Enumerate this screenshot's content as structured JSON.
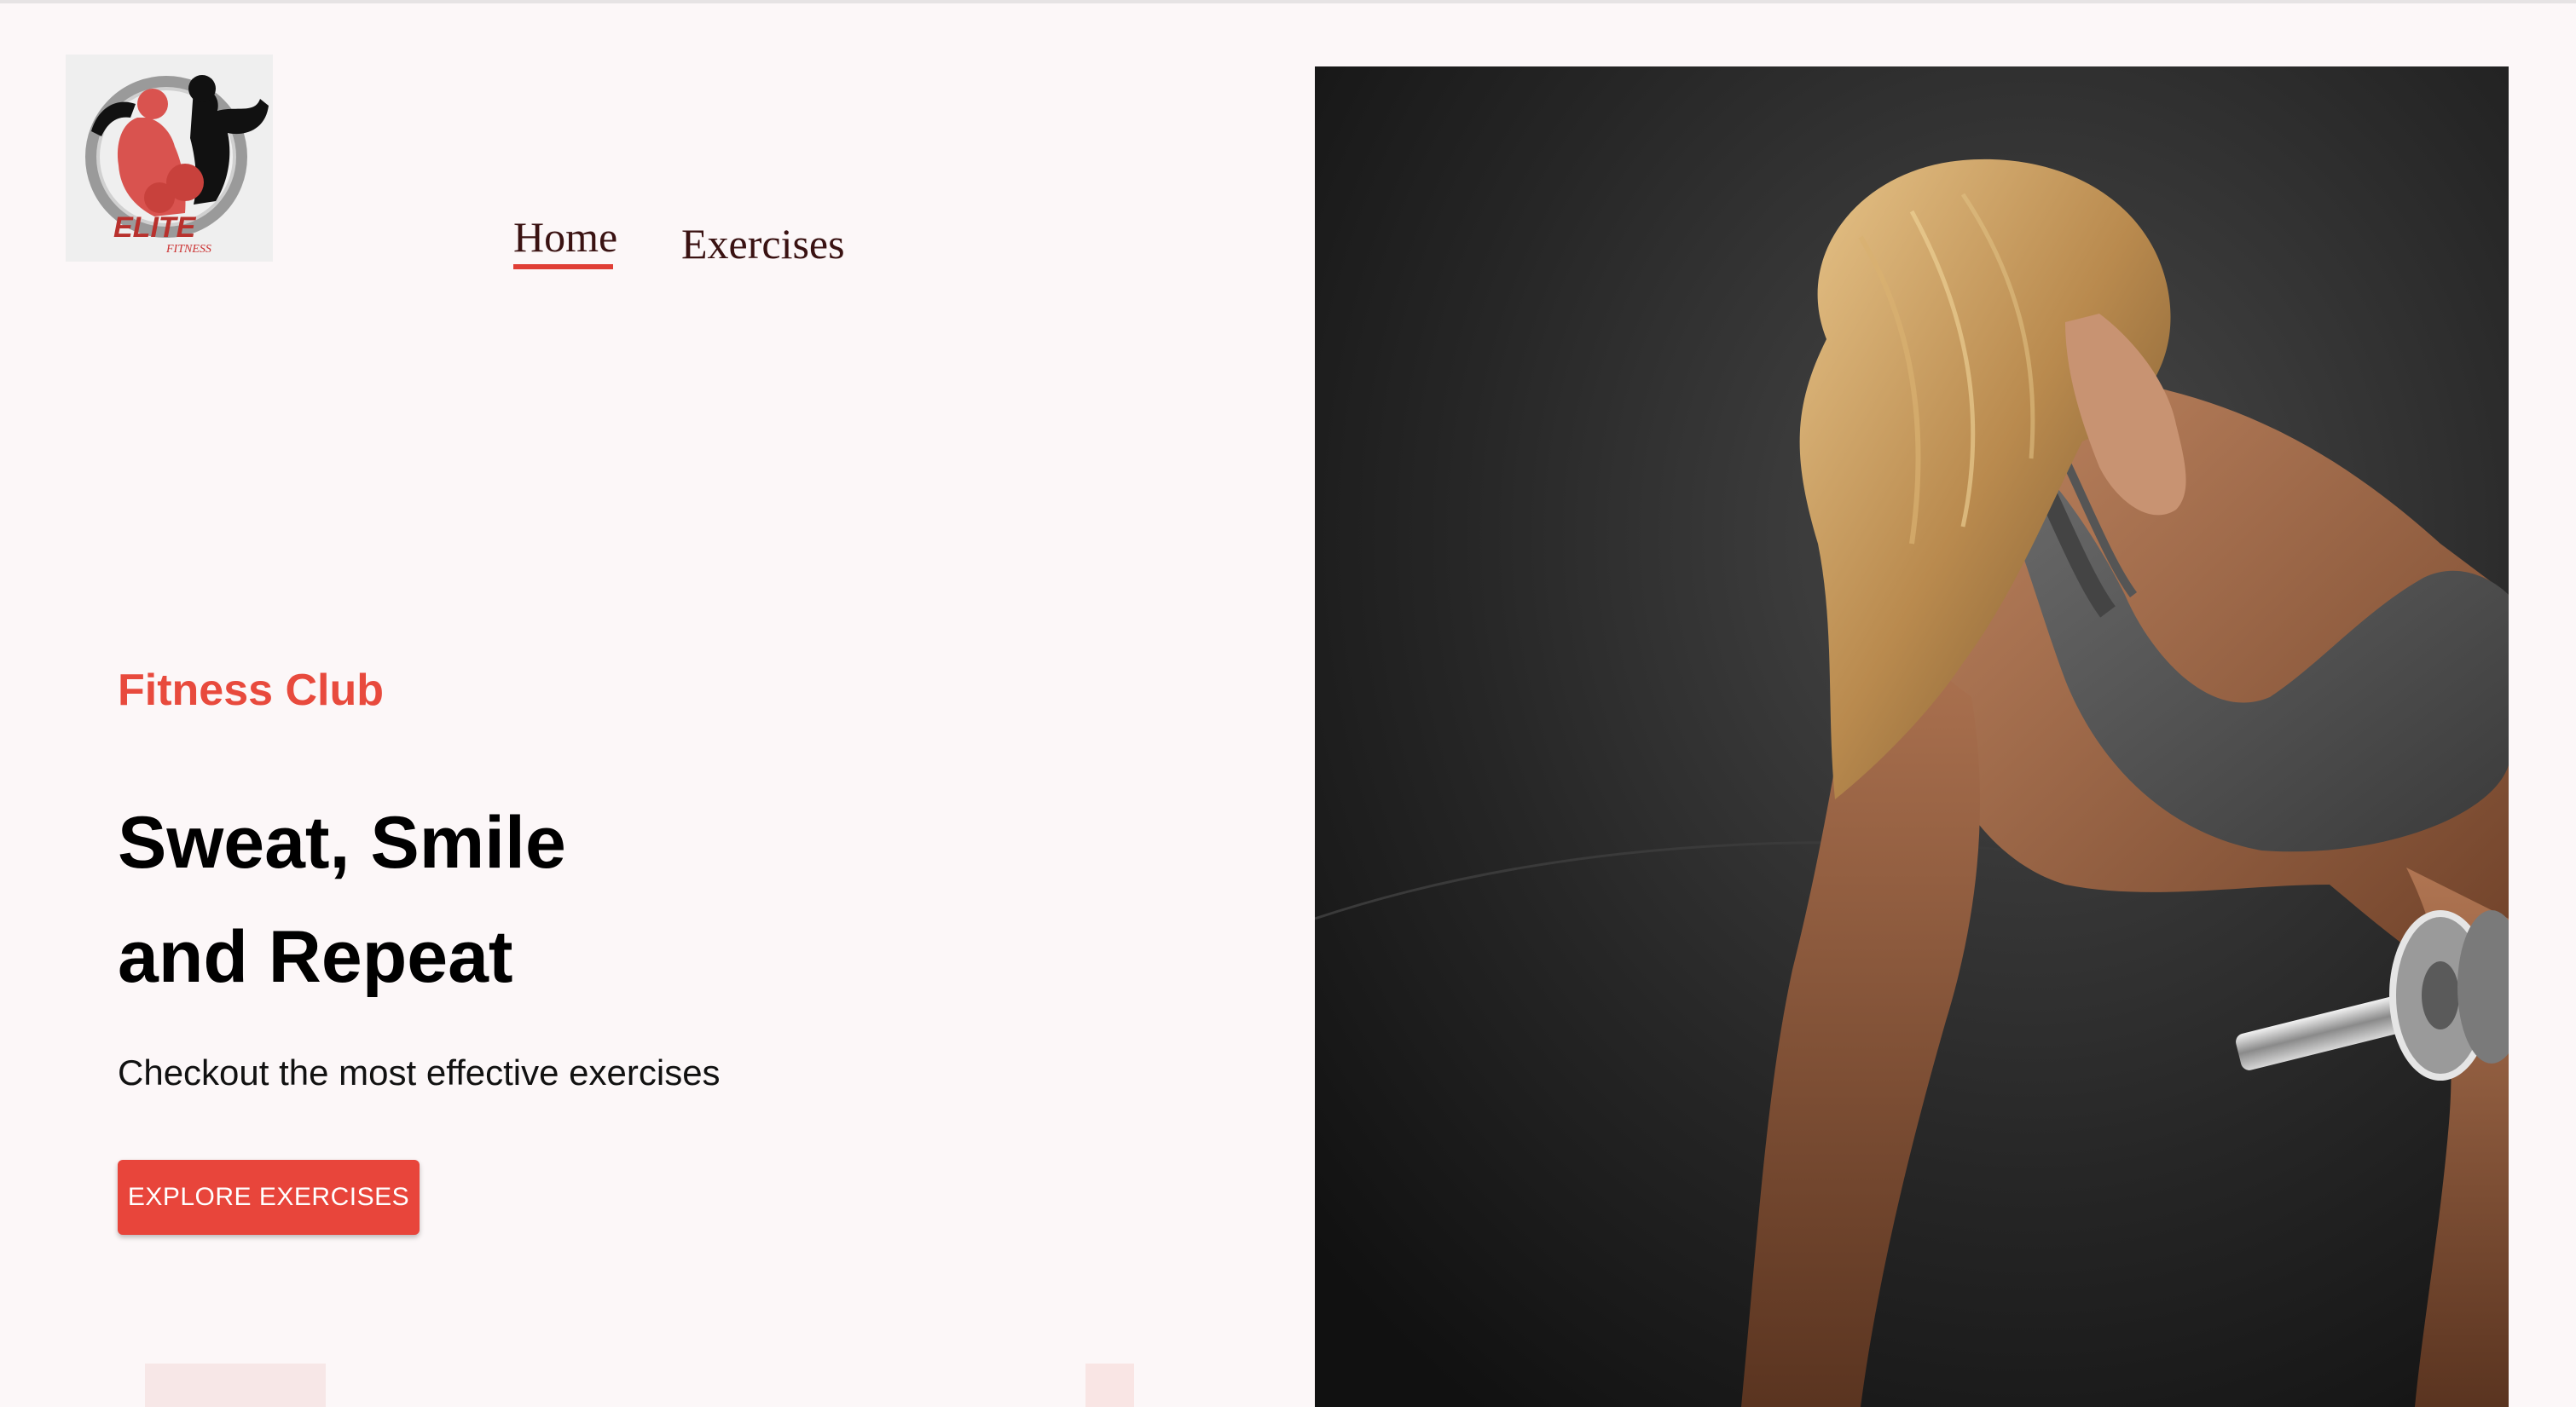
{
  "logo": {
    "alt": "Elite Fitness logo",
    "text_main": "ELITE",
    "text_sub": "FITNESS"
  },
  "nav": {
    "items": [
      {
        "label": "Home",
        "active": true
      },
      {
        "label": "Exercises",
        "active": false
      }
    ]
  },
  "hero": {
    "eyebrow": "Fitness Club",
    "title_line1": "Sweat, Smile",
    "title_line2": "and Repeat",
    "subtitle": "Checkout the most effective exercises",
    "cta_label": "EXPLORE EXERCISES",
    "image_alt": "Woman lifting a dumbbell"
  },
  "colors": {
    "accent": "#e8453b",
    "background": "#fcf7f8",
    "text": "#000000"
  }
}
